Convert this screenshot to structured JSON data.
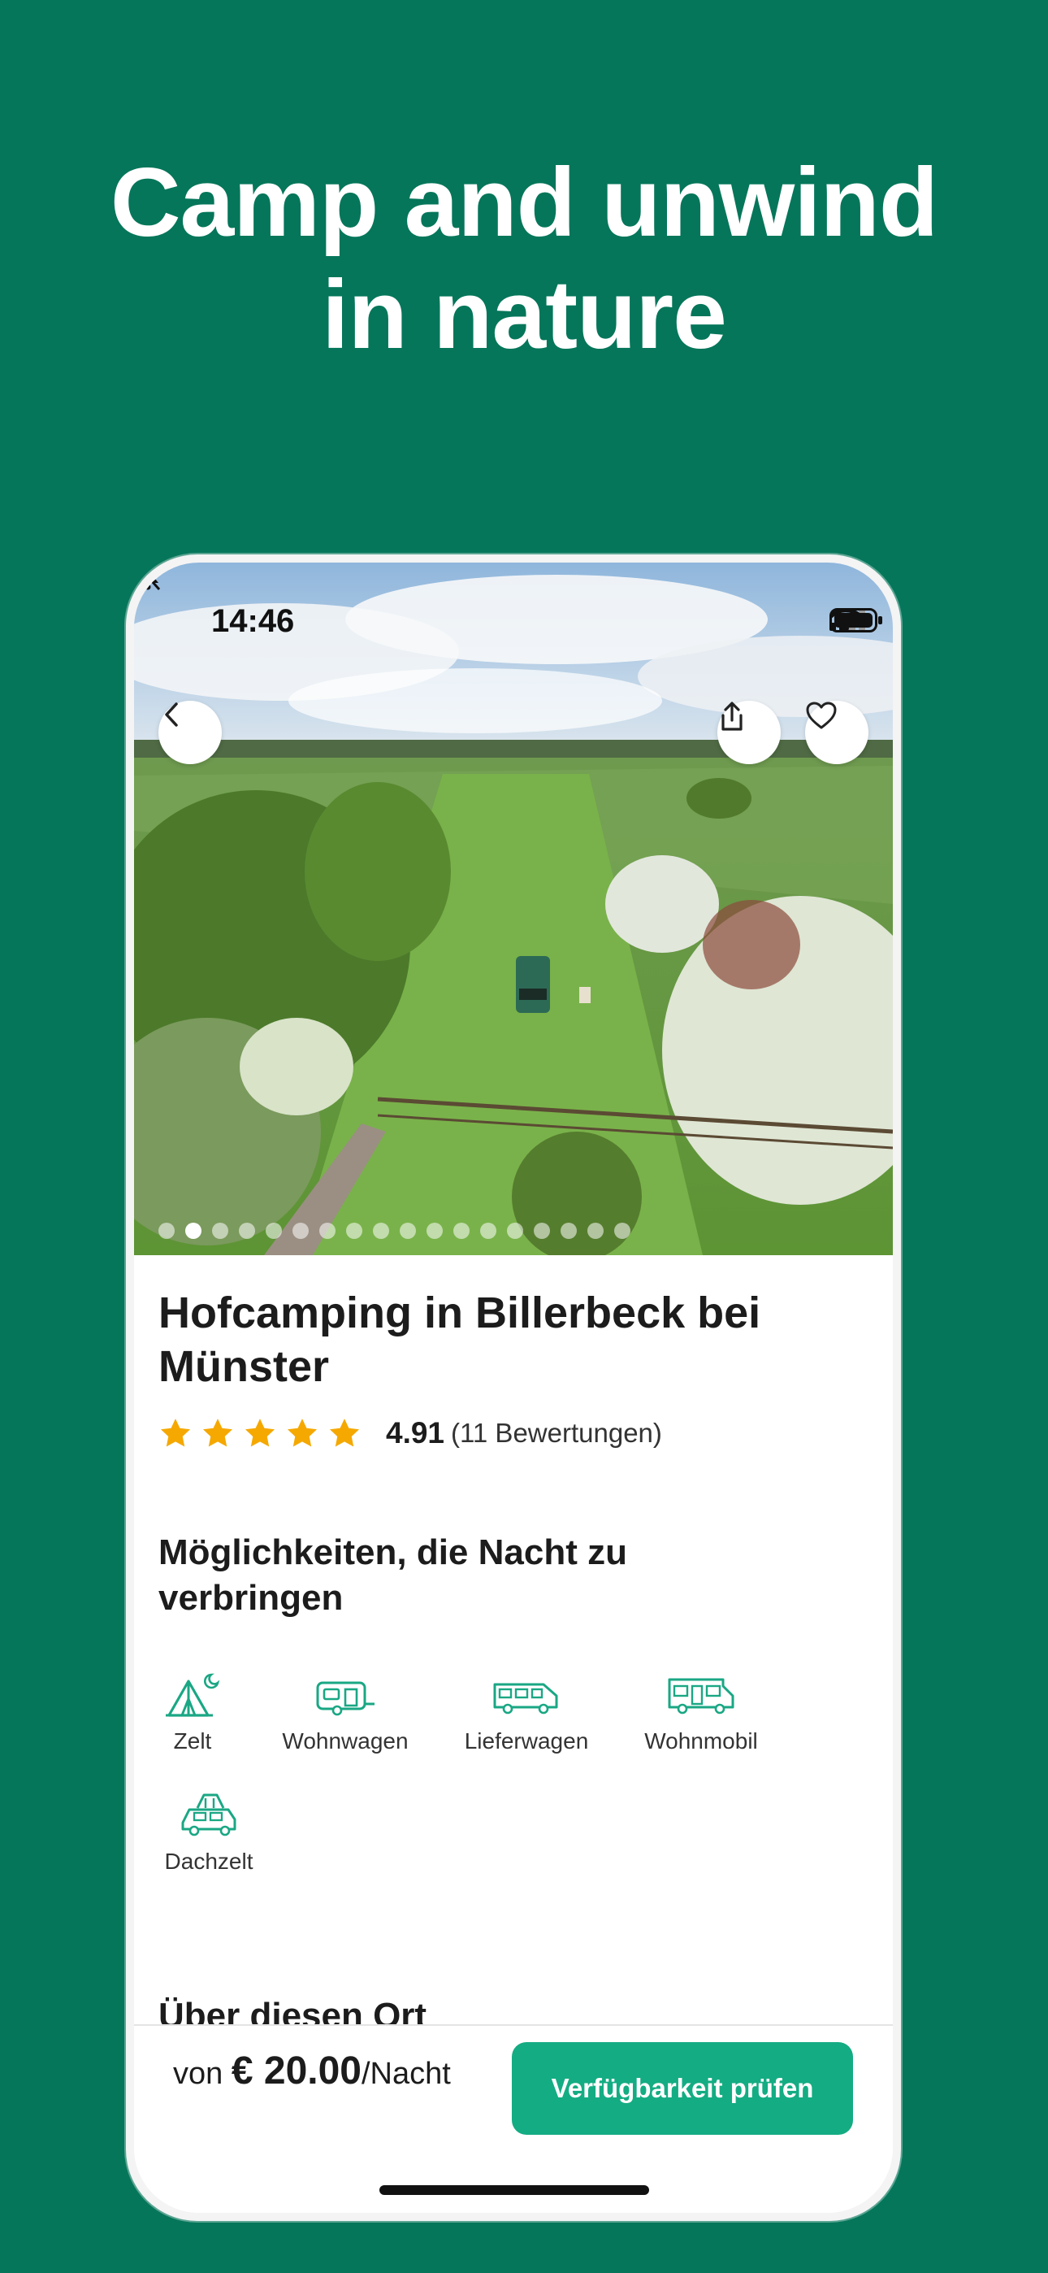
{
  "headline": {
    "line1": "Camp and unwind",
    "line2": "in nature"
  },
  "status_bar": {
    "time": "14:46"
  },
  "hero": {
    "image_count": 18,
    "active_index": 1
  },
  "listing": {
    "title": "Hofcamping in Billerbeck bei Münster",
    "rating": {
      "stars": 5,
      "score": "4.91",
      "count_text": "(11 Bewertungen)"
    }
  },
  "stay_options": {
    "heading": "Möglichkeiten, die Nacht zu verbringen",
    "items": [
      {
        "label": "Zelt",
        "icon": "tent-icon"
      },
      {
        "label": "Wohnwagen",
        "icon": "caravan-icon"
      },
      {
        "label": "Lieferwagen",
        "icon": "van-icon"
      },
      {
        "label": "Wohnmobil",
        "icon": "motorhome-icon"
      },
      {
        "label": "Dachzelt",
        "icon": "rooftop-tent-icon"
      }
    ]
  },
  "about": {
    "heading": "Über diesen Ort"
  },
  "booking": {
    "prefix": "von",
    "price": "€ 20.00",
    "unit": "/Nacht",
    "cta_label": "Verfügbarkeit prüfen"
  },
  "colors": {
    "background": "#05765a",
    "accent": "#14ac83",
    "star": "#f5a800",
    "icon": "#1aa784"
  }
}
